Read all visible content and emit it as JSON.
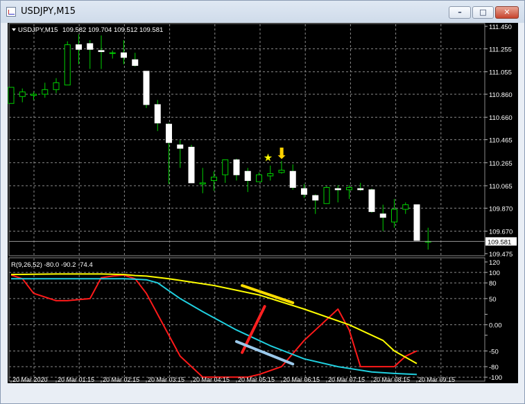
{
  "window": {
    "title": "USDJPY,M15",
    "min_label": "–",
    "max_label": "□",
    "close_label": "✕"
  },
  "chart_data": [
    {
      "type": "candlestick",
      "symbol_label": "USDJPY,M15",
      "ohlc_label": "109.582 109.704 109.512 109.581",
      "current_price_label": "109.581",
      "ylim": [
        109.475,
        111.45
      ],
      "yticks": [
        111.45,
        111.255,
        111.055,
        110.86,
        110.66,
        110.465,
        110.265,
        110.065,
        109.87,
        109.67,
        109.475
      ],
      "ytick_labels": [
        "111.450",
        "111.255",
        "111.055",
        "110.860",
        "110.660",
        "110.465",
        "110.265",
        "110.065",
        "109.870",
        "109.670",
        "109.475"
      ],
      "current_price": 109.581,
      "candles": [
        {
          "o": 110.78,
          "h": 110.92,
          "l": 110.78,
          "c": 110.92
        },
        {
          "o": 110.84,
          "h": 110.91,
          "l": 110.79,
          "c": 110.88
        },
        {
          "o": 110.85,
          "h": 110.88,
          "l": 110.81,
          "c": 110.86
        },
        {
          "o": 110.86,
          "h": 110.96,
          "l": 110.83,
          "c": 110.9
        },
        {
          "o": 110.9,
          "h": 111.0,
          "l": 110.87,
          "c": 110.96
        },
        {
          "o": 110.94,
          "h": 111.32,
          "l": 110.94,
          "c": 111.29
        },
        {
          "o": 111.29,
          "h": 111.38,
          "l": 111.12,
          "c": 111.25
        },
        {
          "o": 111.3,
          "h": 111.33,
          "l": 111.08,
          "c": 111.25
        },
        {
          "o": 111.24,
          "h": 111.37,
          "l": 111.08,
          "c": 111.23
        },
        {
          "o": 111.22,
          "h": 111.24,
          "l": 111.17,
          "c": 111.22
        },
        {
          "o": 111.22,
          "h": 111.33,
          "l": 111.12,
          "c": 111.18
        },
        {
          "o": 111.16,
          "h": 111.22,
          "l": 111.1,
          "c": 111.11
        },
        {
          "o": 111.06,
          "h": 111.06,
          "l": 110.74,
          "c": 110.77
        },
        {
          "o": 110.77,
          "h": 110.81,
          "l": 110.54,
          "c": 110.61
        },
        {
          "o": 110.6,
          "h": 110.61,
          "l": 110.08,
          "c": 110.44
        },
        {
          "o": 110.42,
          "h": 110.46,
          "l": 110.22,
          "c": 110.39
        },
        {
          "o": 110.4,
          "h": 110.42,
          "l": 110.09,
          "c": 110.09
        },
        {
          "o": 110.08,
          "h": 110.22,
          "l": 110.0,
          "c": 110.09
        },
        {
          "o": 110.11,
          "h": 110.19,
          "l": 110.02,
          "c": 110.14
        },
        {
          "o": 110.16,
          "h": 110.29,
          "l": 110.09,
          "c": 110.29
        },
        {
          "o": 110.29,
          "h": 110.3,
          "l": 110.11,
          "c": 110.16
        },
        {
          "o": 110.19,
          "h": 110.22,
          "l": 110.01,
          "c": 110.11
        },
        {
          "o": 110.1,
          "h": 110.18,
          "l": 110.1,
          "c": 110.16
        },
        {
          "o": 110.15,
          "h": 110.24,
          "l": 110.11,
          "c": 110.17
        },
        {
          "o": 110.18,
          "h": 110.28,
          "l": 110.17,
          "c": 110.2
        },
        {
          "o": 110.19,
          "h": 110.25,
          "l": 110.03,
          "c": 110.05
        },
        {
          "o": 110.04,
          "h": 110.08,
          "l": 109.96,
          "c": 109.99
        },
        {
          "o": 109.98,
          "h": 109.99,
          "l": 109.82,
          "c": 109.94
        },
        {
          "o": 109.91,
          "h": 110.06,
          "l": 109.91,
          "c": 110.05
        },
        {
          "o": 110.04,
          "h": 110.07,
          "l": 109.92,
          "c": 110.03
        },
        {
          "o": 110.03,
          "h": 110.07,
          "l": 109.95,
          "c": 110.05
        },
        {
          "o": 110.04,
          "h": 110.09,
          "l": 110.02,
          "c": 110.03
        },
        {
          "o": 110.03,
          "h": 110.04,
          "l": 109.83,
          "c": 109.84
        },
        {
          "o": 109.82,
          "h": 109.9,
          "l": 109.67,
          "c": 109.79
        },
        {
          "o": 109.75,
          "h": 109.95,
          "l": 109.7,
          "c": 109.86
        },
        {
          "o": 109.86,
          "h": 109.92,
          "l": 109.82,
          "c": 109.9
        },
        {
          "o": 109.9,
          "h": 109.9,
          "l": 109.59,
          "c": 109.59
        },
        {
          "o": 109.58,
          "h": 109.7,
          "l": 109.51,
          "c": 109.581
        }
      ],
      "annotations": [
        {
          "kind": "star",
          "label": "★",
          "candle_index": 23,
          "price": 110.29,
          "color": "#ffff00"
        },
        {
          "kind": "arrow-down",
          "label": "⬇",
          "candle_index": 24,
          "price": 110.33,
          "color": "#ffd200"
        }
      ]
    },
    {
      "type": "line",
      "title": "R(9,26,52) -80.0 -90.2 -74.4",
      "ylim": [
        -105,
        120
      ],
      "yticks": [
        120,
        100,
        80,
        50,
        20,
        0,
        -20,
        -50,
        -80,
        -100
      ],
      "ytick_labels": [
        "120",
        "100",
        "80",
        "50",
        "",
        "0.00",
        "",
        "-50",
        "-80",
        "-100"
      ],
      "categories": [
        "20 Mar 2020",
        "20 Mar 01:15",
        "20 Mar 02:15",
        "20 Mar 03:15",
        "20 Mar 04:15",
        "20 Mar 05:15",
        "20 Mar 06:15",
        "20 Mar 07:15",
        "20 Mar 08:15",
        "20 Mar 09:15"
      ],
      "x": [
        0,
        4,
        8,
        12,
        16,
        20,
        24,
        28,
        32,
        36
      ],
      "series": [
        {
          "color": "#ff1a1a",
          "x": [
            0,
            1,
            2,
            4,
            5,
            6,
            7,
            8,
            9,
            10,
            11,
            12,
            13,
            15,
            17,
            18,
            20,
            21,
            22,
            24,
            25,
            26,
            27,
            29,
            30,
            31,
            34,
            35,
            36
          ],
          "values": [
            95,
            88,
            60,
            46,
            46,
            48,
            50,
            90,
            93,
            95,
            88,
            60,
            20,
            -60,
            -100,
            -100,
            -100,
            -100,
            -95,
            -80,
            -55,
            -30,
            -10,
            30,
            -10,
            -80,
            -80,
            -60,
            -50
          ]
        },
        {
          "color": "#20d0e0",
          "x": [
            0,
            3,
            6,
            10,
            11,
            12,
            13,
            14,
            15,
            17,
            20,
            23,
            26,
            29,
            32,
            34,
            36
          ],
          "values": [
            88,
            88,
            88,
            88,
            87,
            86,
            80,
            65,
            50,
            25,
            -10,
            -40,
            -65,
            -80,
            -90,
            -93,
            -95
          ]
        },
        {
          "color": "#ffff00",
          "x": [
            0,
            4,
            8,
            10,
            11,
            12,
            14,
            18,
            22,
            26,
            30,
            33,
            34,
            36
          ],
          "values": [
            96,
            97,
            97,
            96,
            94,
            93,
            88,
            75,
            57,
            30,
            0,
            -30,
            -50,
            -74
          ]
        }
      ],
      "trendlines": [
        {
          "color": "#ffdd00",
          "x": [
            20.5,
            25
          ],
          "values": [
            75,
            42
          ]
        },
        {
          "color": "#ff2020",
          "x": [
            20.5,
            22.5
          ],
          "values": [
            -53,
            35
          ]
        },
        {
          "color": "#9ac8ea",
          "x": [
            20,
            25
          ],
          "values": [
            -32,
            -75
          ]
        }
      ]
    }
  ]
}
